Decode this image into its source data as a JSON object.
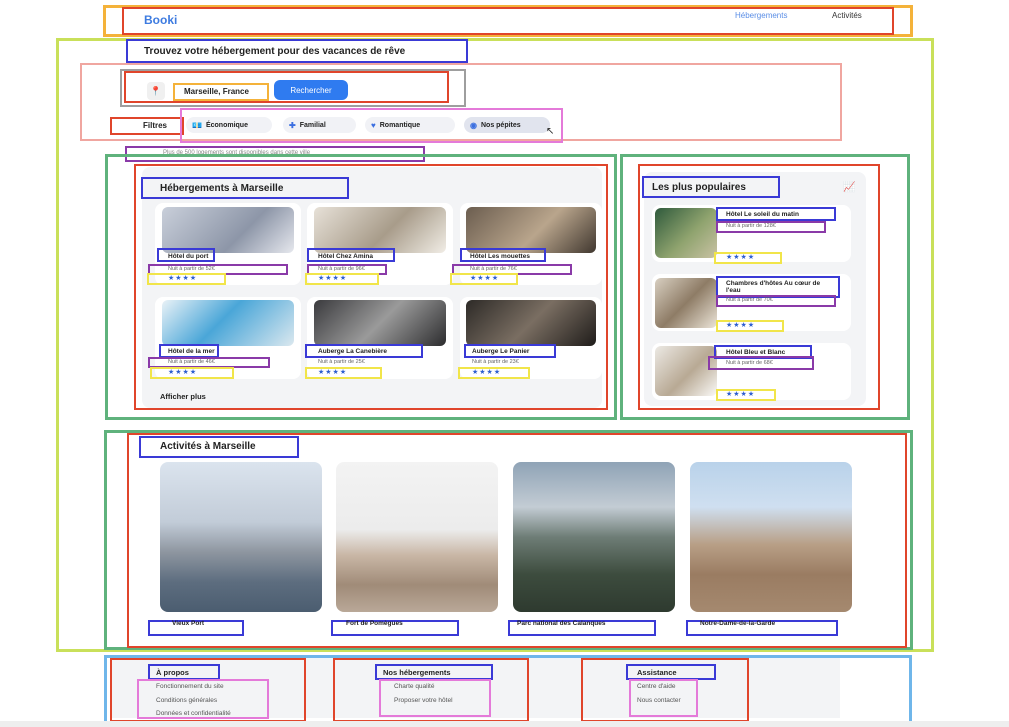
{
  "header": {
    "logo": "Booki",
    "nav": [
      {
        "label": "Hébergements"
      },
      {
        "label": "Activités"
      }
    ]
  },
  "hero": {
    "headline": "Trouvez votre hébergement pour des vacances de rêve",
    "search": {
      "pin_icon": "location-pin-icon",
      "value": "Marseille, France",
      "button": "Rechercher"
    },
    "filters": {
      "label": "Filtres",
      "chips": [
        {
          "label": "Économique",
          "icon": "money-icon",
          "glyph": "💶"
        },
        {
          "label": "Familial",
          "icon": "child-icon",
          "glyph": "♟"
        },
        {
          "label": "Romantique",
          "icon": "heart-icon",
          "glyph": "♥"
        },
        {
          "label": "Nos pépites",
          "icon": "gem-icon",
          "glyph": "◉"
        }
      ]
    },
    "info": "Plus de 500 logements sont disponibles dans cette ville"
  },
  "hebergements": {
    "title": "Hébergements à Marseille",
    "cards": [
      {
        "name": "Hôtel du port",
        "price": "Nuit à partir de 52€",
        "stars": "★★★★"
      },
      {
        "name": "Hôtel Chez Amina",
        "price": "Nuit à partir de 96€",
        "stars": "★★★★"
      },
      {
        "name": "Hôtel Les mouettes",
        "price": "Nuit à partir de 76€",
        "stars": "★★★★"
      },
      {
        "name": "Hôtel de la mer",
        "price": "Nuit à partir de 46€",
        "stars": "★★★★"
      },
      {
        "name": "Auberge La Canebière",
        "price": "Nuit à partir de 25€",
        "stars": "★★★★"
      },
      {
        "name": "Auberge Le Panier",
        "price": "Nuit à partir de 23€",
        "stars": "★★★★"
      }
    ],
    "show_more": "Afficher plus"
  },
  "populaires": {
    "title": "Les plus populaires",
    "icon": "chart-icon",
    "cards": [
      {
        "name": "Hôtel Le soleil du matin",
        "price": "Nuit à partir de 128€",
        "stars": "★★★★"
      },
      {
        "name": "Chambres d'hôtes Au cœur de l'eau",
        "price": "Nuit à partir de 70€",
        "stars": "★★★★"
      },
      {
        "name": "Hôtel Bleu et Blanc",
        "price": "Nuit à partir de 68€",
        "stars": "★★★★"
      }
    ]
  },
  "activites": {
    "title": "Activités à Marseille",
    "items": [
      {
        "label": "Vieux Port"
      },
      {
        "label": "Fort de Pomègues"
      },
      {
        "label": "Parc national des Calanques"
      },
      {
        "label": "Notre-Dame-de-la-Garde"
      }
    ]
  },
  "footer": {
    "columns": [
      {
        "title": "À propos",
        "links": [
          "Fonctionnement du site",
          "Conditions générales",
          "Données et confidentialité"
        ]
      },
      {
        "title": "Nos hébergements",
        "links": [
          "Charte qualité",
          "Proposer votre hôtel"
        ]
      },
      {
        "title": "Assistance",
        "links": [
          "Centre d'aide",
          "Nous contacter"
        ]
      }
    ]
  },
  "colors": {
    "accent": "#2f7bf0",
    "stars": "#2f5fcf"
  }
}
